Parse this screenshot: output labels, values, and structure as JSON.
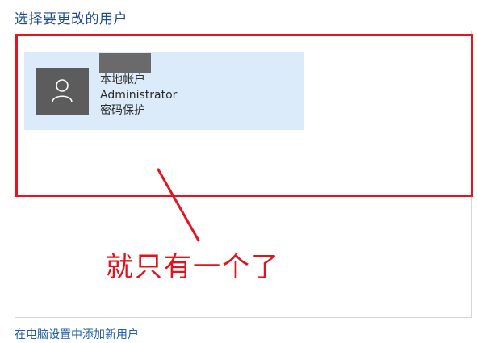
{
  "header": {
    "title": "选择要更改的用户"
  },
  "user_tile": {
    "account_type": "本地帐户",
    "user_name": "Administrator",
    "password_status": "密码保护",
    "avatar_icon": "user-icon"
  },
  "annotation": {
    "text": "就只有一个了",
    "color": "#e0141e"
  },
  "footer": {
    "add_user_link": "在电脑设置中添加新用户"
  },
  "colors": {
    "accent": "#1f4e8c",
    "tile_background": "#dcebf9",
    "highlight": "#e5141f"
  }
}
